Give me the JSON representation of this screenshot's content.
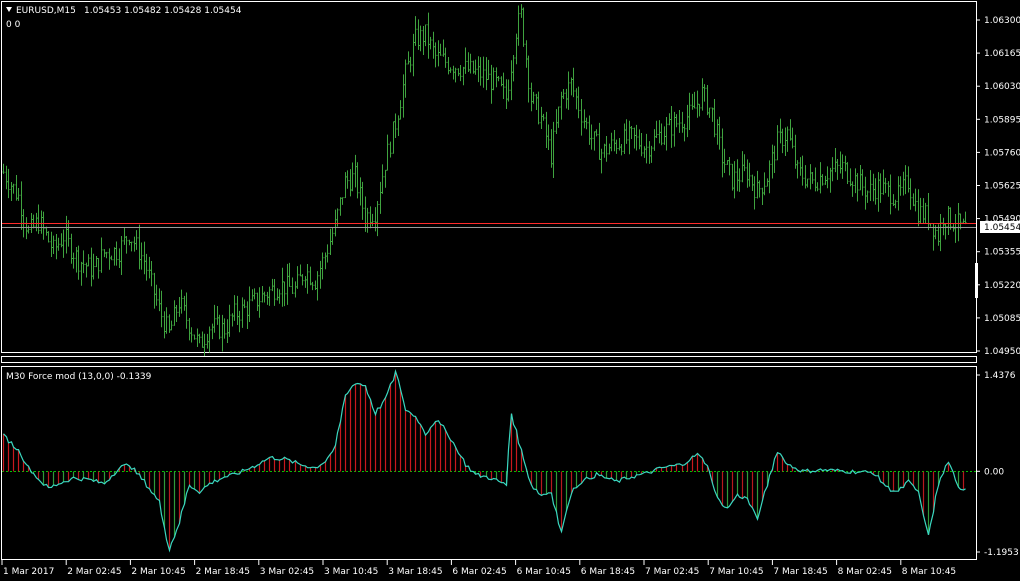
{
  "colors": {
    "background": "#000000",
    "frame": "#ffffff",
    "candle": "#3fa33f",
    "bid_line": "#ff2a2a",
    "ask_line": "#9a9a9a",
    "force_up": "#c8191e",
    "force_down": "#b8191e",
    "force_line": "#3ad8c0",
    "zero_line": "#00c400"
  },
  "header": {
    "icon": "triangle-down-icon",
    "symbol": "EURUSD,M15",
    "ohlc": "1.05453 1.05482 1.05428 1.05454",
    "sub": "0  0"
  },
  "price_axis": {
    "labels": [
      "1.06300",
      "1.06165",
      "1.06030",
      "1.05895",
      "1.05760",
      "1.05625",
      "1.05490",
      "1.05355",
      "1.05220",
      "1.05085",
      "1.04950"
    ],
    "values": [
      1.063,
      1.06165,
      1.0603,
      1.05895,
      1.0576,
      1.05625,
      1.0549,
      1.05355,
      1.0522,
      1.05085,
      1.0495
    ],
    "current_bid": "1.05454",
    "current_bid_value": 1.05454,
    "ask_value": 1.05472
  },
  "indicator": {
    "title": "M30 Force mod (13,0,0) -0.1339",
    "axis_labels": [
      "1.4376",
      "0.00",
      "-1.1953"
    ],
    "axis_values": [
      1.4376,
      0.0,
      -1.1953
    ]
  },
  "time_axis": {
    "labels": [
      "1 Mar 2017",
      "2 Mar 02:45",
      "2 Mar 10:45",
      "2 Mar 18:45",
      "3 Mar 02:45",
      "3 Mar 10:45",
      "3 Mar 18:45",
      "6 Mar 02:45",
      "6 Mar 10:45",
      "6 Mar 18:45",
      "7 Mar 02:45",
      "7 Mar 10:45",
      "7 Mar 18:45",
      "8 Mar 02:45",
      "8 Mar 10:45"
    ]
  },
  "chart_data": [
    {
      "type": "ohlc",
      "symbol": "EURUSD,M15",
      "ylim": [
        1.0495,
        1.063
      ],
      "close_path": [
        [
          0,
          1.0568
        ],
        [
          6,
          1.0558
        ],
        [
          10,
          1.0543
        ],
        [
          14,
          1.0548
        ],
        [
          20,
          1.0536
        ],
        [
          24,
          1.0542
        ],
        [
          30,
          1.0532
        ],
        [
          36,
          1.0528
        ],
        [
          40,
          1.0535
        ],
        [
          46,
          1.0536
        ],
        [
          50,
          1.0543
        ],
        [
          56,
          1.0532
        ],
        [
          62,
          1.0512
        ],
        [
          66,
          1.0502
        ],
        [
          70,
          1.0515
        ],
        [
          74,
          1.0506
        ],
        [
          78,
          1.0497
        ],
        [
          82,
          1.0505
        ],
        [
          88,
          1.0504
        ],
        [
          92,
          1.051
        ],
        [
          96,
          1.0512
        ],
        [
          104,
          1.0518
        ],
        [
          110,
          1.0522
        ],
        [
          116,
          1.052
        ],
        [
          120,
          1.0528
        ],
        [
          124,
          1.0524
        ],
        [
          128,
          1.0534
        ],
        [
          132,
          1.0546
        ],
        [
          136,
          1.0564
        ],
        [
          140,
          1.0566
        ],
        [
          144,
          1.055
        ],
        [
          148,
          1.0552
        ],
        [
          152,
          1.0572
        ],
        [
          156,
          1.0588
        ],
        [
          160,
          1.0608
        ],
        [
          164,
          1.0622
        ],
        [
          168,
          1.0624
        ],
        [
          172,
          1.0615
        ],
        [
          178,
          1.0612
        ],
        [
          184,
          1.061
        ],
        [
          190,
          1.0608
        ],
        [
          196,
          1.0604
        ],
        [
          200,
          1.0598
        ],
        [
          204,
          1.0626
        ],
        [
          206,
          1.0632
        ],
        [
          210,
          1.0598
        ],
        [
          214,
          1.059
        ],
        [
          218,
          1.0575
        ],
        [
          222,
          1.0598
        ],
        [
          226,
          1.0604
        ],
        [
          230,
          1.0592
        ],
        [
          234,
          1.0582
        ],
        [
          238,
          1.0576
        ],
        [
          244,
          1.058
        ],
        [
          250,
          1.0582
        ],
        [
          256,
          1.0578
        ],
        [
          262,
          1.0584
        ],
        [
          268,
          1.0588
        ],
        [
          274,
          1.0592
        ],
        [
          278,
          1.06
        ],
        [
          282,
          1.0592
        ],
        [
          286,
          1.0574
        ],
        [
          290,
          1.0565
        ],
        [
          296,
          1.0568
        ],
        [
          300,
          1.056
        ],
        [
          304,
          1.0566
        ],
        [
          308,
          1.058
        ],
        [
          312,
          1.0584
        ],
        [
          316,
          1.0568
        ],
        [
          322,
          1.0564
        ],
        [
          328,
          1.0568
        ],
        [
          334,
          1.057
        ],
        [
          338,
          1.0566
        ],
        [
          344,
          1.056
        ],
        [
          348,
          1.0562
        ],
        [
          352,
          1.056
        ],
        [
          356,
          1.0558
        ],
        [
          360,
          1.0564
        ],
        [
          364,
          1.0552
        ],
        [
          368,
          1.055
        ],
        [
          372,
          1.0542
        ],
        [
          374,
          1.055
        ],
        [
          378,
          1.0548
        ],
        [
          382,
          1.0545
        ]
      ]
    },
    {
      "type": "bar",
      "name": "M30 Force mod (13,0,0)",
      "ylim": [
        -1.1953,
        1.4376
      ],
      "path": [
        [
          0,
          0.52
        ],
        [
          6,
          0.3
        ],
        [
          10,
          0.05
        ],
        [
          14,
          -0.12
        ],
        [
          18,
          -0.25
        ],
        [
          22,
          -0.18
        ],
        [
          28,
          -0.1
        ],
        [
          34,
          -0.12
        ],
        [
          40,
          -0.18
        ],
        [
          46,
          0.05
        ],
        [
          50,
          0.1
        ],
        [
          56,
          -0.15
        ],
        [
          62,
          -0.45
        ],
        [
          66,
          -1.15
        ],
        [
          70,
          -0.75
        ],
        [
          74,
          -0.2
        ],
        [
          78,
          -0.3
        ],
        [
          82,
          -0.18
        ],
        [
          88,
          -0.08
        ],
        [
          92,
          -0.05
        ],
        [
          100,
          0.08
        ],
        [
          106,
          0.2
        ],
        [
          112,
          0.18
        ],
        [
          118,
          0.1
        ],
        [
          124,
          0.05
        ],
        [
          128,
          0.15
        ],
        [
          132,
          0.35
        ],
        [
          136,
          1.1
        ],
        [
          140,
          1.3
        ],
        [
          144,
          1.25
        ],
        [
          148,
          0.85
        ],
        [
          152,
          1.05
        ],
        [
          156,
          1.45
        ],
        [
          160,
          0.9
        ],
        [
          164,
          0.8
        ],
        [
          168,
          0.55
        ],
        [
          172,
          0.75
        ],
        [
          176,
          0.6
        ],
        [
          180,
          0.35
        ],
        [
          184,
          0.1
        ],
        [
          188,
          -0.05
        ],
        [
          194,
          -0.1
        ],
        [
          200,
          -0.2
        ],
        [
          202,
          0.85
        ],
        [
          206,
          0.3
        ],
        [
          210,
          -0.2
        ],
        [
          214,
          -0.35
        ],
        [
          218,
          -0.3
        ],
        [
          222,
          -0.9
        ],
        [
          226,
          -0.3
        ],
        [
          230,
          -0.15
        ],
        [
          236,
          -0.05
        ],
        [
          244,
          -0.15
        ],
        [
          250,
          -0.08
        ],
        [
          256,
          -0.03
        ],
        [
          262,
          0.05
        ],
        [
          270,
          0.1
        ],
        [
          276,
          0.25
        ],
        [
          280,
          0.1
        ],
        [
          284,
          -0.4
        ],
        [
          288,
          -0.55
        ],
        [
          292,
          -0.35
        ],
        [
          296,
          -0.4
        ],
        [
          300,
          -0.7
        ],
        [
          304,
          -0.2
        ],
        [
          308,
          0.3
        ],
        [
          312,
          0.1
        ],
        [
          318,
          0.0
        ],
        [
          326,
          0.02
        ],
        [
          336,
          0.0
        ],
        [
          346,
          -0.02
        ],
        [
          352,
          -0.25
        ],
        [
          356,
          -0.3
        ],
        [
          360,
          -0.15
        ],
        [
          364,
          -0.3
        ],
        [
          368,
          -0.95
        ],
        [
          372,
          -0.2
        ],
        [
          376,
          0.15
        ],
        [
          380,
          -0.25
        ]
      ]
    }
  ]
}
